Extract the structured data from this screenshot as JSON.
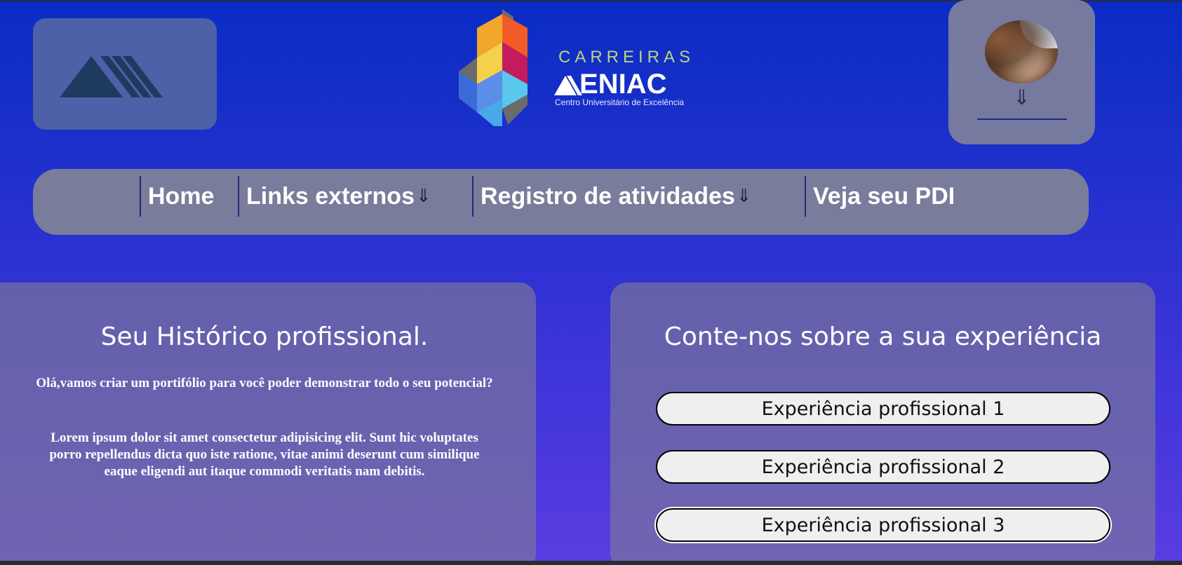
{
  "brand": {
    "title": "CARREIRAS",
    "name": "ENIAC",
    "subtitle": "Centro Universitário de Excelência"
  },
  "profile": {
    "arrow": "⇓"
  },
  "nav": {
    "items": [
      {
        "label": "Home",
        "arrow": ""
      },
      {
        "label": "Links externos",
        "arrow": "⇓"
      },
      {
        "label": "Registro de atividades",
        "arrow": "⇓"
      },
      {
        "label": "Veja seu PDI",
        "arrow": ""
      }
    ]
  },
  "history": {
    "title": "Seu Histórico profissional.",
    "intro": "Olá,vamos criar um portifólio para você poder demonstrar todo o seu potencial?",
    "body": "Lorem ipsum dolor sit amet consectetur adipisicing elit. Sunt hic voluptates porro repellendus dicta quo iste ratione, vitae animi deserunt cum similique eaque eligendi aut itaque commodi veritatis nam debitis."
  },
  "experience": {
    "title": "Conte-nos sobre a sua experiência",
    "buttons": [
      {
        "label": "Experiência profissional 1"
      },
      {
        "label": "Experiência profissional 2"
      },
      {
        "label": "Experiência profissional 3"
      }
    ]
  },
  "colors": {
    "background_top": "#0a2cc4",
    "background_bottom": "#5a3de0",
    "panel": "#7a7c9b",
    "card": "#6762af",
    "brand_accent": "#b9d77a"
  }
}
